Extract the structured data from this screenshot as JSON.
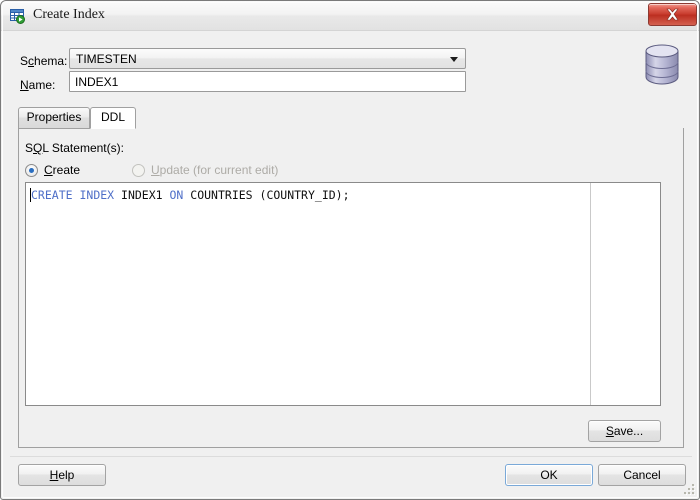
{
  "window": {
    "title": "Create Index",
    "title_icon": "index-table-icon",
    "close_icon": "close-icon",
    "resize_grip_icon": "resize-grip-icon"
  },
  "form": {
    "schema_label_pre": "S",
    "schema_label_accel": "c",
    "schema_label_post": "hema:",
    "schema_value": "TIMESTEN",
    "schema_dropdown_icon": "chevron-down-icon",
    "name_label_pre": "",
    "name_label_accel": "N",
    "name_label_post": "ame:",
    "name_value": "INDEX1",
    "name_placeholder": "",
    "database_icon": "database-cylinder-icon"
  },
  "tabs": [
    {
      "label": "Properties",
      "active": false
    },
    {
      "label": "DDL",
      "active": true
    }
  ],
  "ddl_panel": {
    "caption_pre": "S",
    "caption_accel": "Q",
    "caption_post": "L Statement(s):",
    "radios": [
      {
        "label_pre": "",
        "label_accel": "C",
        "label_post": "reate",
        "checked": true,
        "disabled": false
      },
      {
        "label_pre": "",
        "label_accel": "U",
        "label_post": "pdate (for current edit)",
        "checked": false,
        "disabled": true
      }
    ],
    "sql_tokens": [
      {
        "text": "CREATE",
        "type": "keyword"
      },
      {
        "text": " ",
        "type": "plain"
      },
      {
        "text": "INDEX",
        "type": "keyword"
      },
      {
        "text": " INDEX1 ",
        "type": "plain"
      },
      {
        "text": "ON",
        "type": "keyword"
      },
      {
        "text": " COUNTRIES (COUNTRY_ID);",
        "type": "plain"
      }
    ],
    "sql_full_text": "CREATE INDEX INDEX1 ON COUNTRIES (COUNTRY_ID);",
    "save_label_pre": "",
    "save_label_accel": "S",
    "save_label_post": "ave..."
  },
  "footer": {
    "help_label_pre": "",
    "help_label_accel": "H",
    "help_label_post": "elp",
    "ok_label": "OK",
    "cancel_label": "Cancel"
  },
  "colors": {
    "keyword_blue": "#4f6fc8",
    "accent_focus": "#7aa9d8",
    "close_red": "#c6392b"
  }
}
